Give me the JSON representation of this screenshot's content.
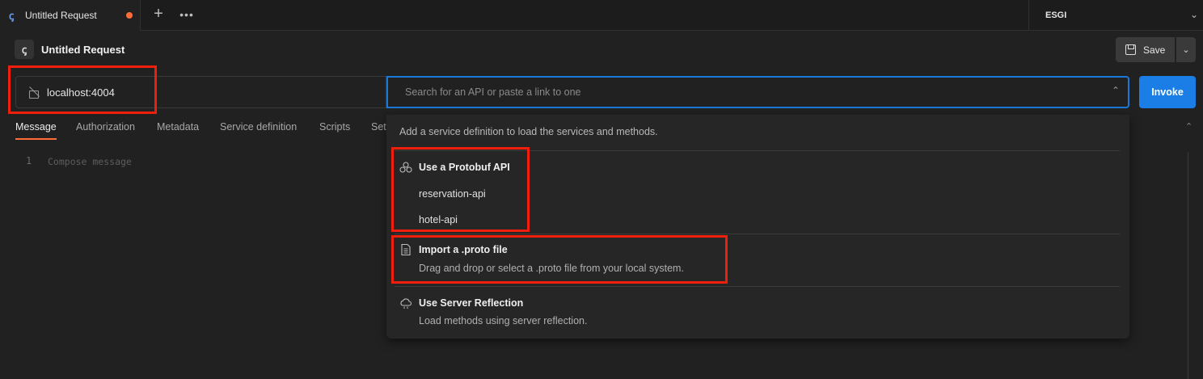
{
  "tab": {
    "title": "Untitled Request",
    "icon": "grpc-icon",
    "unsaved_dot_color": "#ff6c37",
    "new_tab": "+",
    "more": "•••"
  },
  "environment": {
    "name": "ESGI"
  },
  "request": {
    "title": "Untitled Request",
    "save_label": "Save"
  },
  "url": {
    "value": "localhost:4004"
  },
  "method_select": {
    "placeholder": "Search for an API or paste a link to one"
  },
  "invoke": {
    "label": "Invoke",
    "color": "#1a7ee6"
  },
  "subtabs": [
    "Message",
    "Authorization",
    "Metadata",
    "Service definition",
    "Scripts",
    "Set"
  ],
  "editor": {
    "line_number": "1",
    "placeholder": "Compose message"
  },
  "dropdown": {
    "hint": "Add a service definition to load the services and methods.",
    "protobuf": {
      "title": "Use a Protobuf API",
      "items": [
        "reservation-api",
        "hotel-api"
      ]
    },
    "proto_file": {
      "title": "Import a .proto file",
      "description": "Drag and drop or select a .proto file from your local system."
    },
    "reflection": {
      "title": "Use Server Reflection",
      "description": "Load methods using server reflection."
    }
  },
  "highlight_color": "#f01e0c"
}
